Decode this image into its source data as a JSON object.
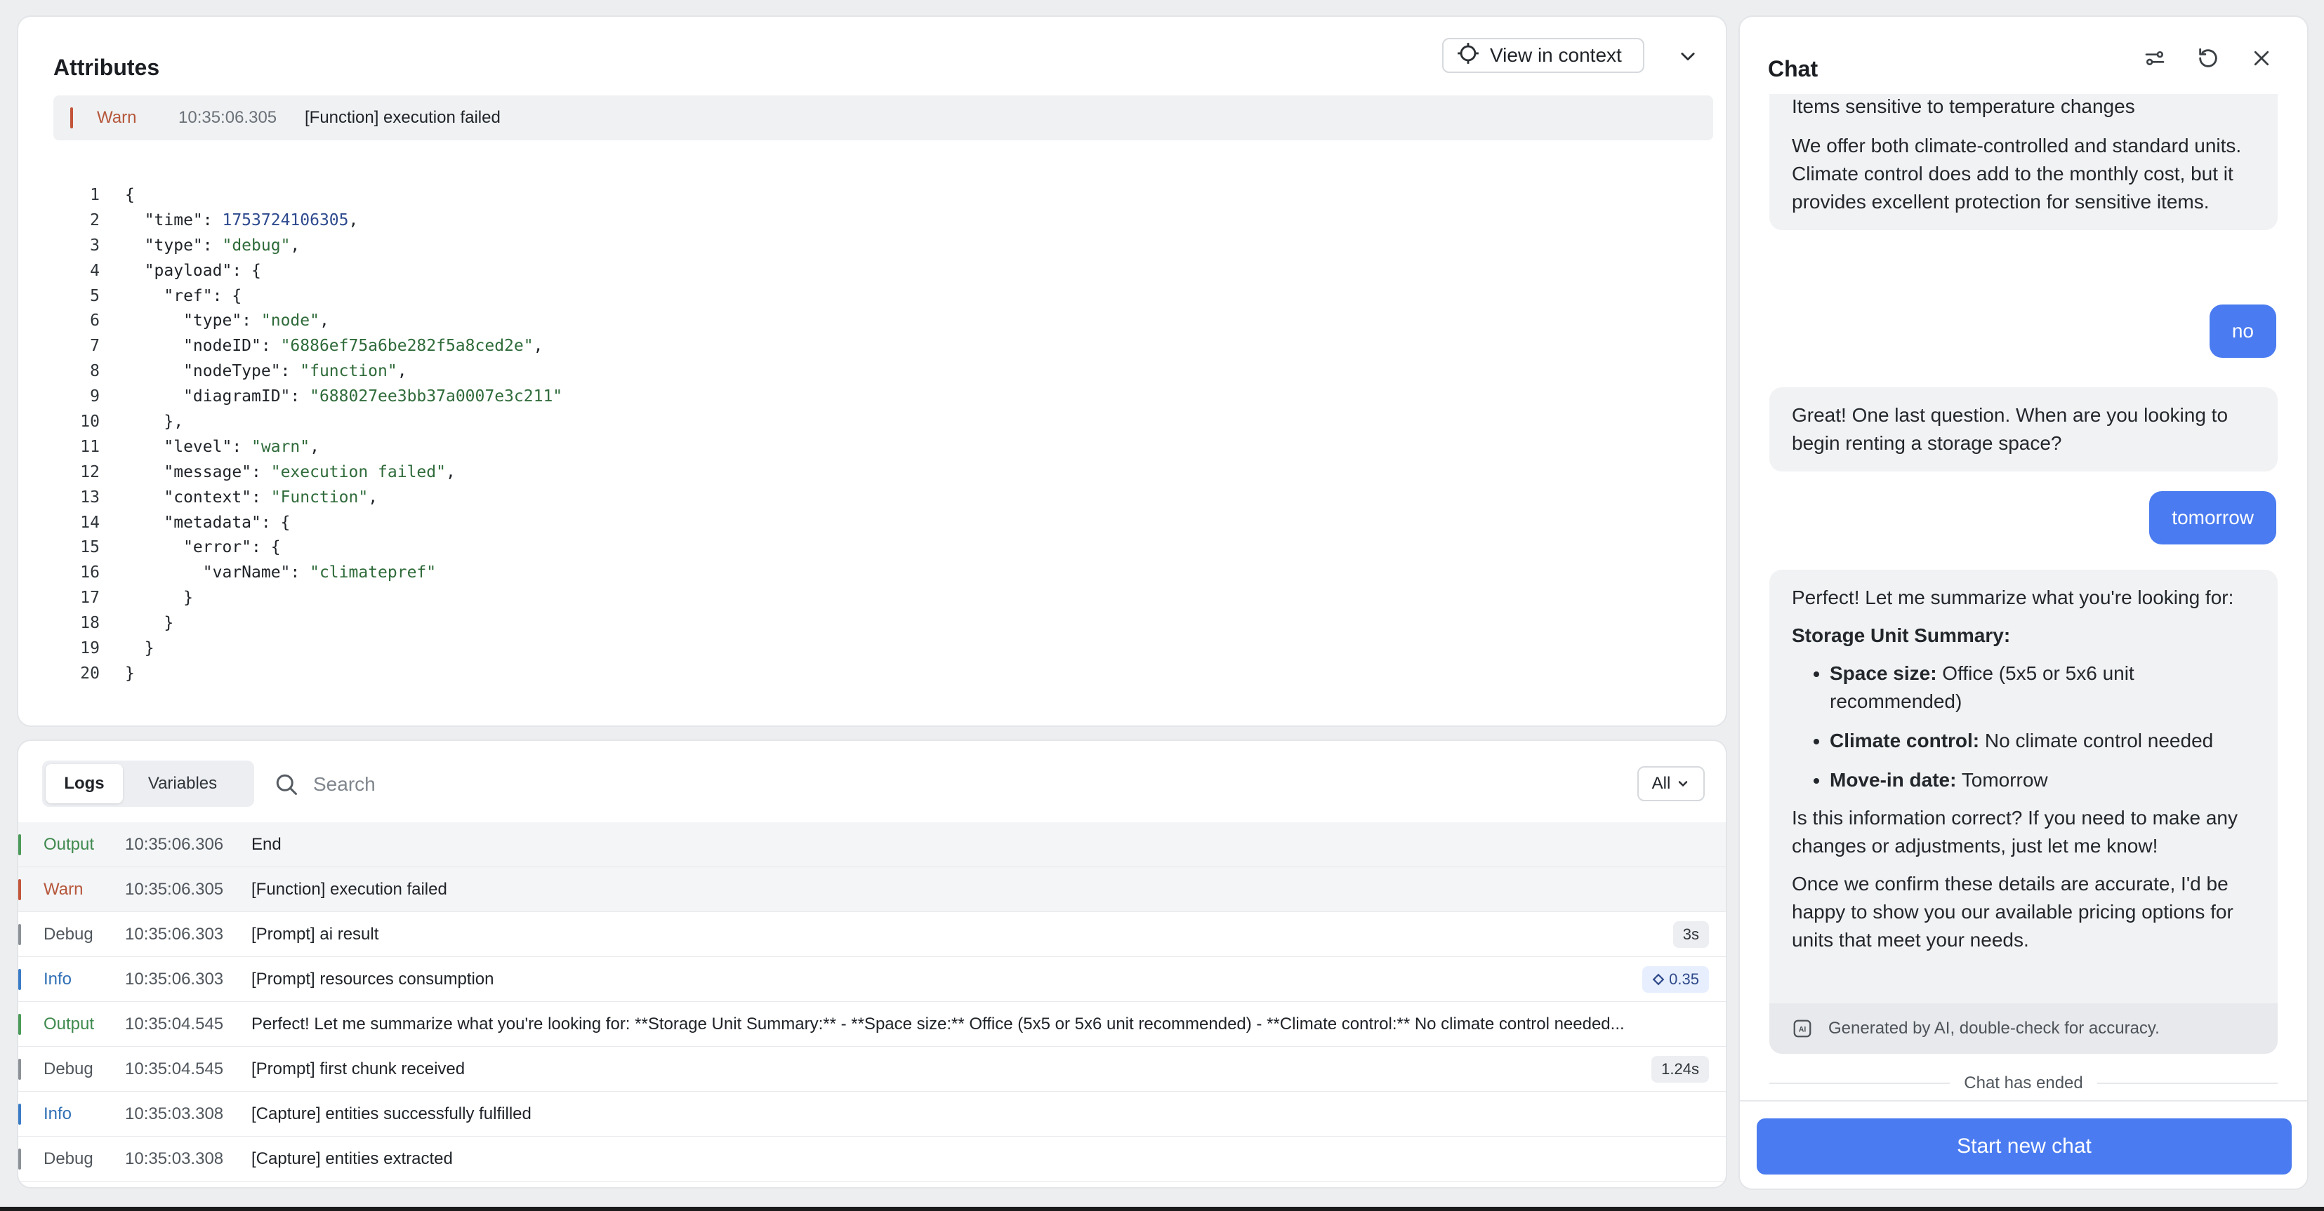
{
  "attributes": {
    "title": "Attributes",
    "view_in_context": "View in context",
    "selected_log": {
      "level": "Warn",
      "timestamp": "10:35:06.305",
      "message": "[Function] execution failed"
    },
    "code_lines": [
      {
        "n": "1",
        "text": "{"
      },
      {
        "n": "2",
        "text": "  \"time\": 1753724106305,"
      },
      {
        "n": "3",
        "text": "  \"type\": \"debug\","
      },
      {
        "n": "4",
        "text": "  \"payload\": {"
      },
      {
        "n": "5",
        "text": "    \"ref\": {"
      },
      {
        "n": "6",
        "text": "      \"type\": \"node\","
      },
      {
        "n": "7",
        "text": "      \"nodeID\": \"6886ef75a6be282f5a8ced2e\","
      },
      {
        "n": "8",
        "text": "      \"nodeType\": \"function\","
      },
      {
        "n": "9",
        "text": "      \"diagramID\": \"688027ee3bb37a0007e3c211\""
      },
      {
        "n": "10",
        "text": "    },"
      },
      {
        "n": "11",
        "text": "    \"level\": \"warn\","
      },
      {
        "n": "12",
        "text": "    \"message\": \"execution failed\","
      },
      {
        "n": "13",
        "text": "    \"context\": \"Function\","
      },
      {
        "n": "14",
        "text": "    \"metadata\": {"
      },
      {
        "n": "15",
        "text": "      \"error\": {"
      },
      {
        "n": "16",
        "text": "        \"varName\": \"climatepref\""
      },
      {
        "n": "17",
        "text": "      }"
      },
      {
        "n": "18",
        "text": "    }"
      },
      {
        "n": "19",
        "text": "  }"
      },
      {
        "n": "20",
        "text": "}"
      }
    ]
  },
  "logs": {
    "tabs": {
      "logs": "Logs",
      "variables": "Variables"
    },
    "search_placeholder": "Search",
    "filter": "All",
    "rows": [
      {
        "level": "Output",
        "kind": "output",
        "timestamp": "10:35:06.306",
        "message": "End",
        "badge": ""
      },
      {
        "level": "Warn",
        "kind": "warn",
        "timestamp": "10:35:06.305",
        "message": "[Function] execution failed",
        "badge": "",
        "selected": true
      },
      {
        "level": "Debug",
        "kind": "debug",
        "timestamp": "10:35:06.303",
        "message": "[Prompt] ai result",
        "badge": "3s"
      },
      {
        "level": "Info",
        "kind": "info",
        "timestamp": "10:35:06.303",
        "message": "[Prompt] resources consumption",
        "badge": "0.35",
        "badge_icon": true
      },
      {
        "level": "Output",
        "kind": "output",
        "timestamp": "10:35:04.545",
        "message": "Perfect! Let me summarize what you're looking for: **Storage Unit Summary:** - **Space size:** Office (5x5 or 5x6 unit recommended) - **Climate control:** No climate control needed...",
        "badge": ""
      },
      {
        "level": "Debug",
        "kind": "debug",
        "timestamp": "10:35:04.545",
        "message": "[Prompt] first chunk received",
        "badge": "1.24s"
      },
      {
        "level": "Info",
        "kind": "info",
        "timestamp": "10:35:03.308",
        "message": "[Capture] entities successfully fulfilled",
        "badge": ""
      },
      {
        "level": "Debug",
        "kind": "debug",
        "timestamp": "10:35:03.308",
        "message": "[Capture] entities extracted",
        "badge": ""
      }
    ]
  },
  "chat": {
    "title": "Chat",
    "messages": {
      "bot1": {
        "line1": "Items sensitive to temperature changes",
        "para": "We offer both climate-controlled and standard units. Climate control does add to the monthly cost, but it provides excellent protection for sensitive items."
      },
      "user1": "no",
      "bot2": "Great! One last question. When are you looking to begin renting a storage space?",
      "user2": "tomorrow",
      "bot3": {
        "intro": "Perfect! Let me summarize what you're looking for:",
        "summary_heading": "Storage Unit Summary:",
        "items": [
          {
            "label": "Space size:",
            "value": " Office (5x5 or 5x6 unit recommended)"
          },
          {
            "label": "Climate control:",
            "value": " No climate control needed"
          },
          {
            "label": "Move-in date:",
            "value": " Tomorrow"
          }
        ],
        "question": "Is this information correct? If you need to make any changes or adjustments, just let me know!",
        "closing": "Once we confirm these details are accurate, I'd be happy to show you our available pricing options for units that meet your needs."
      }
    },
    "ai_disclaimer": "Generated by AI, double-check for accuracy.",
    "ended_label": "Chat has ended",
    "start_new_chat": "Start new chat"
  }
}
